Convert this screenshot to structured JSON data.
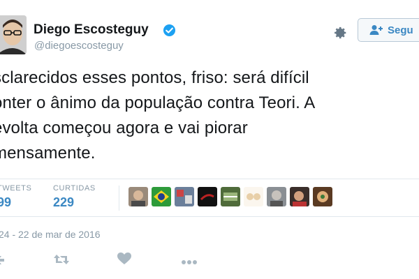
{
  "tweet": {
    "display_name": "Diego Escosteguy",
    "screen_name": "@diegoescosteguy",
    "follow_label": "Segu",
    "text_lines": [
      "sclarecidos esses pontos, friso: será difícil",
      "onter o ânimo da população contra Teori. A",
      "evolta começou agora e vai piorar",
      "mensamente."
    ],
    "stats": {
      "retweets_label": "TWEETS",
      "retweets_value": "99",
      "likes_label": "CURTIDAS",
      "likes_value": "229"
    },
    "timestamp": "24 - 22 de mar de 2016"
  },
  "icons": {
    "verified": "verified-badge-icon",
    "settings": "gear-icon",
    "follow": "add-person-icon",
    "reply": "reply-icon",
    "retweet": "retweet-icon",
    "like": "heart-icon",
    "more": "more-dots-icon"
  },
  "colors": {
    "brand_blue": "#3b88c3",
    "verified_blue": "#1da1f2",
    "muted_gray": "#8899a6",
    "text_dark": "#14171a",
    "divider": "#e1e8ed"
  }
}
